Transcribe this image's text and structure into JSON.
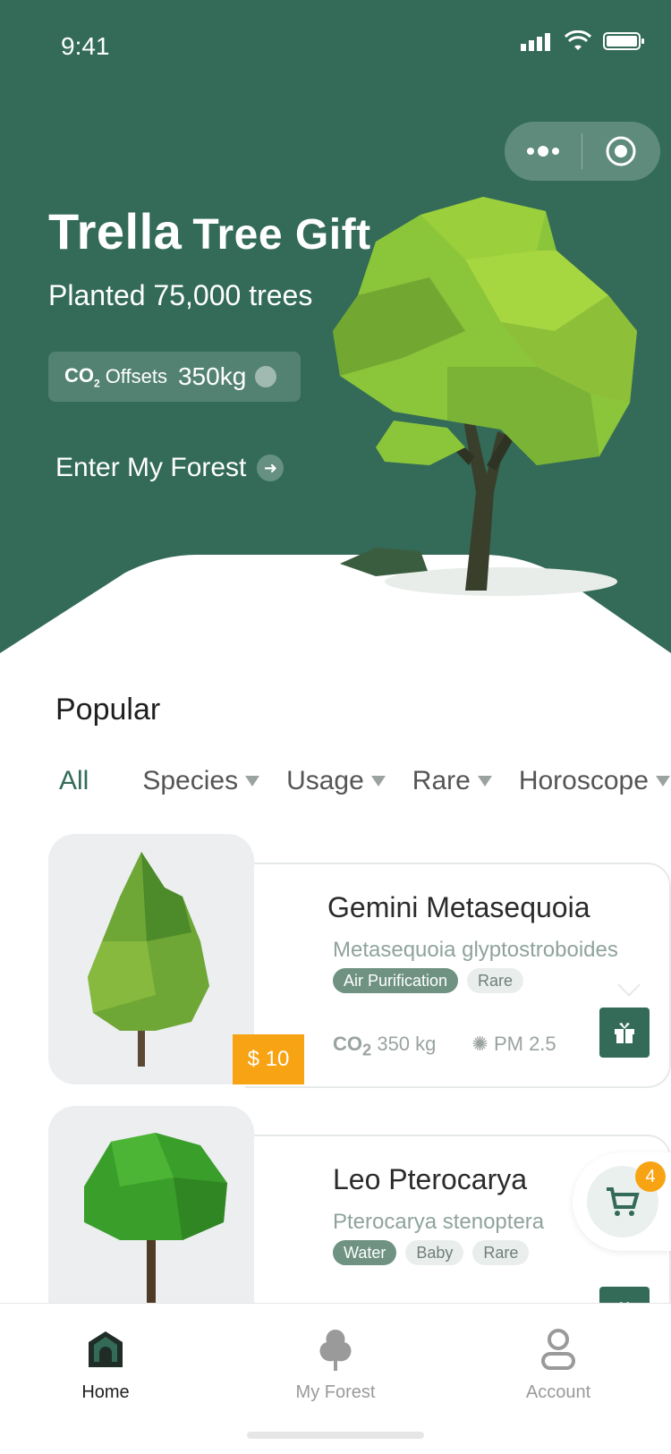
{
  "status": {
    "time": "9:41"
  },
  "hero": {
    "brand": "Trella",
    "brand_suffix": "Tree Gift",
    "subtitle": "Planted 75,000 trees",
    "offset_co2_main": "CO",
    "offset_co2_sub": "2",
    "offset_label": "Offsets",
    "offset_value": "350kg",
    "enter_label": "Enter My Forest"
  },
  "popular": {
    "title": "Popular"
  },
  "filters": [
    {
      "label": "All"
    },
    {
      "label": "Species"
    },
    {
      "label": "Usage"
    },
    {
      "label": "Rare"
    },
    {
      "label": "Horoscope"
    }
  ],
  "cards": [
    {
      "title": "Gemini Metasequoia",
      "subtitle": "Metasequoia glyptostroboides",
      "tags": [
        "Air Purification",
        "Rare"
      ],
      "co2_main": "CO",
      "co2_sub": "2",
      "co2": "350 kg",
      "pm": "PM 2.5",
      "price": "$ 10"
    },
    {
      "title": "Leo Pterocarya",
      "subtitle": "Pterocarya stenoptera",
      "tags": [
        "Water",
        "Baby",
        "Rare"
      ]
    }
  ],
  "cart": {
    "count": "4"
  },
  "tabs": [
    {
      "label": "Home"
    },
    {
      "label": "My Forest"
    },
    {
      "label": "Account"
    }
  ],
  "colors": {
    "primary": "#336b58",
    "accent": "#f7a313"
  }
}
